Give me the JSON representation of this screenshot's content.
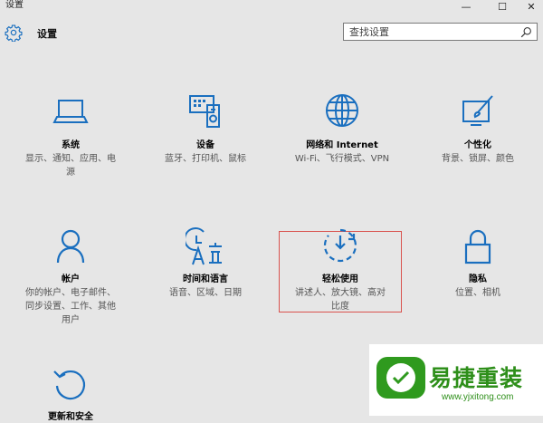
{
  "window": {
    "title": "设置",
    "controls": [
      "—",
      "☐",
      "✕"
    ]
  },
  "header": {
    "title": "设置",
    "icon": "gear-icon"
  },
  "search": {
    "placeholder": "查找设置",
    "value": ""
  },
  "accent_color": "#1a6fbf",
  "tiles": [
    {
      "name": "系统",
      "desc": [
        "显示、通知、应用、电",
        "源"
      ],
      "icon": "laptop-icon"
    },
    {
      "name": "设备",
      "desc": [
        "蓝牙、打印机、鼠标"
      ],
      "icon": "devices-icon"
    },
    {
      "name": "网络和 Internet",
      "desc": [
        "Wi-Fi、飞行模式、VPN"
      ],
      "icon": "globe-icon"
    },
    {
      "name": "个性化",
      "desc": [
        "背景、锁屏、颜色"
      ],
      "icon": "personalize-icon"
    },
    {
      "name": "帐户",
      "desc": [
        "你的帐户、电子邮件、",
        "同步设置、工作、其他",
        "用户"
      ],
      "icon": "person-icon"
    },
    {
      "name": "时间和语言",
      "desc": [
        "语音、区域、日期"
      ],
      "icon": "time-language-icon"
    },
    {
      "name": "轻松使用",
      "desc": [
        "讲述人、放大镜、高对",
        "比度"
      ],
      "icon": "ease-of-access-icon"
    },
    {
      "name": "隐私",
      "desc": [
        "位置、相机"
      ],
      "icon": "lock-icon"
    },
    {
      "name": "更新和安全",
      "desc": [],
      "icon": "update-icon"
    }
  ],
  "watermark": {
    "title": "易捷重装",
    "url": "www.yjxitong.com",
    "color": "#2e8f1a"
  }
}
